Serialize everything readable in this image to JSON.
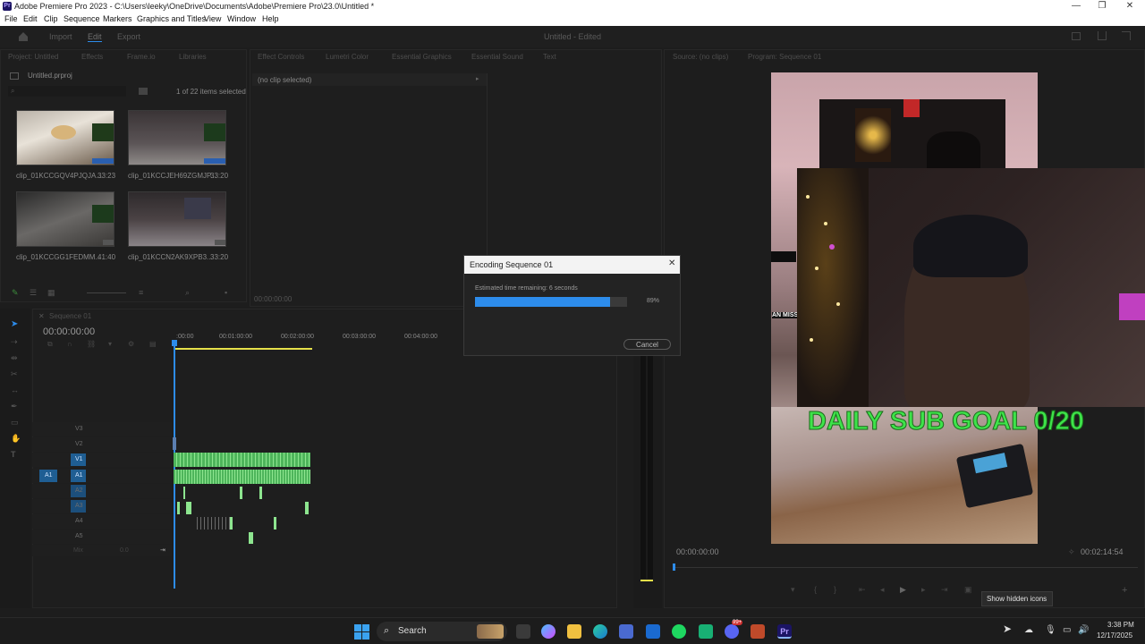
{
  "window": {
    "title": "Adobe Premiere Pro 2023 - C:\\Users\\leeky\\OneDrive\\Documents\\Adobe\\Premiere Pro\\23.0\\Untitled *",
    "minimize": "—",
    "maximize": "❐",
    "close": "✕"
  },
  "menu": [
    "File",
    "Edit",
    "Clip",
    "Sequence",
    "Markers",
    "Graphics and Titles",
    "View",
    "Window",
    "Help"
  ],
  "workspace": {
    "tabs": [
      "Import",
      "Edit",
      "Export"
    ],
    "project_name": "Untitled - Edited"
  },
  "project_panel": {
    "tabs": [
      "Project: Untitled",
      "Effects",
      "Frame.io",
      "Libraries"
    ],
    "file": "Untitled.prproj",
    "selection": "1 of 22 items selected",
    "clips": [
      {
        "name": "clip_01KCCGQV4PJQJA...",
        "duration": "33:23"
      },
      {
        "name": "clip_01KCCJEH69ZGMJP...",
        "duration": "33:20"
      },
      {
        "name": "clip_01KCCGG1FEDMM...",
        "duration": "41:40"
      },
      {
        "name": "clip_01KCCN2AK9XPB3...",
        "duration": "33:20"
      }
    ]
  },
  "effect_controls": {
    "tabs": [
      "Effect Controls",
      "Lumetri Color",
      "Essential Graphics",
      "Essential Sound",
      "Text"
    ],
    "no_clip": "(no clip selected)",
    "timecode": "00:00:00:00"
  },
  "program_monitor": {
    "tabs": [
      "Source: (no clips)",
      "Program: Sequence 01"
    ],
    "overlay_text": "DAILY SUB GOAL 0/20",
    "side_text": "AN MISS /",
    "timecode_left": "00:00:00:00",
    "timecode_right": "00:02:14:54",
    "tooltip": "Show hidden icons"
  },
  "timeline": {
    "tab": "Sequence 01",
    "timecode": "00:00:00:00",
    "ruler": [
      ":00:00",
      "00:01:00:00",
      "00:02:00:00",
      "00:03:00:00",
      "00:04:00:00"
    ],
    "video_tracks": [
      "V3",
      "V2",
      "V1"
    ],
    "audio_tracks": [
      "A1",
      "A2",
      "A3",
      "A4",
      "A5"
    ],
    "source_patch": "A1",
    "mix": "Mix",
    "mix_value": "0.0"
  },
  "encoding_dialog": {
    "title": "Encoding Sequence 01",
    "status": "Estimated time remaining: 6 seconds",
    "progress_percent": 89,
    "progress_label": "89%",
    "cancel": "Cancel"
  },
  "taskbar": {
    "search": "Search",
    "time": "3:38 PM",
    "date": "12/17/2025",
    "badge": "99+"
  },
  "colors": {
    "accent_blue": "#2d8ceb",
    "clip_green": "#4eb55b",
    "overlay_green": "#3ee34a"
  }
}
